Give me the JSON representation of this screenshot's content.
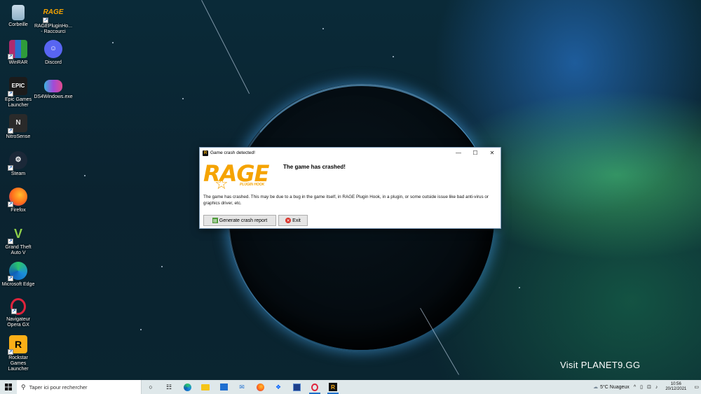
{
  "desktop": {
    "icons": [
      {
        "label": "Corbeille"
      },
      {
        "label": "RAGEPluginHo... - Raccourci",
        "logo_text": "RAGE"
      },
      {
        "label": "WinRAR"
      },
      {
        "label": "Discord"
      },
      {
        "label": "Epic Games Launcher",
        "logo_text": "EPIC"
      },
      {
        "label": "DS4Windows.exe"
      },
      {
        "label": "NitroSense",
        "logo_text": "N"
      },
      {
        "label": "Steam"
      },
      {
        "label": "Firefox"
      },
      {
        "label": "Grand Theft Auto V",
        "logo_text": "V"
      },
      {
        "label": "Microsoft Edge"
      },
      {
        "label": "Navigateur Opera GX"
      },
      {
        "label": "Rockstar Games Launcher",
        "logo_text": "R"
      }
    ],
    "watermark": "Visit PLANET9.GG"
  },
  "dialog": {
    "title": "Game crash detected!",
    "logo_text": "RAGE",
    "logo_subtext": "PLUGIN HOOK",
    "heading": "The game has crashed!",
    "message": "The game has crashed. This may be due to a bug in the game itself, in RAGE Plugin Hook, in a plugin, or some outside issue like bad anti-virus or graphics driver, etc.",
    "buttons": {
      "generate": "Generate crash report",
      "exit": "Exit"
    },
    "controls": {
      "minimize": "—",
      "maximize": "☐",
      "close": "✕"
    }
  },
  "taskbar": {
    "search_placeholder": "Taper ici pour rechercher",
    "weather": "5°C  Nuageux",
    "time": "10:56",
    "date": "20/12/2021",
    "apps": [
      "task-view",
      "widgets",
      "edge",
      "file-explorer",
      "store",
      "mail",
      "firefox",
      "dropbox",
      "app-blue",
      "opera-gx",
      "rockstar"
    ]
  },
  "colors": {
    "rage_orange": "#f5a300",
    "taskbar_bg": "#dfe8ea"
  }
}
